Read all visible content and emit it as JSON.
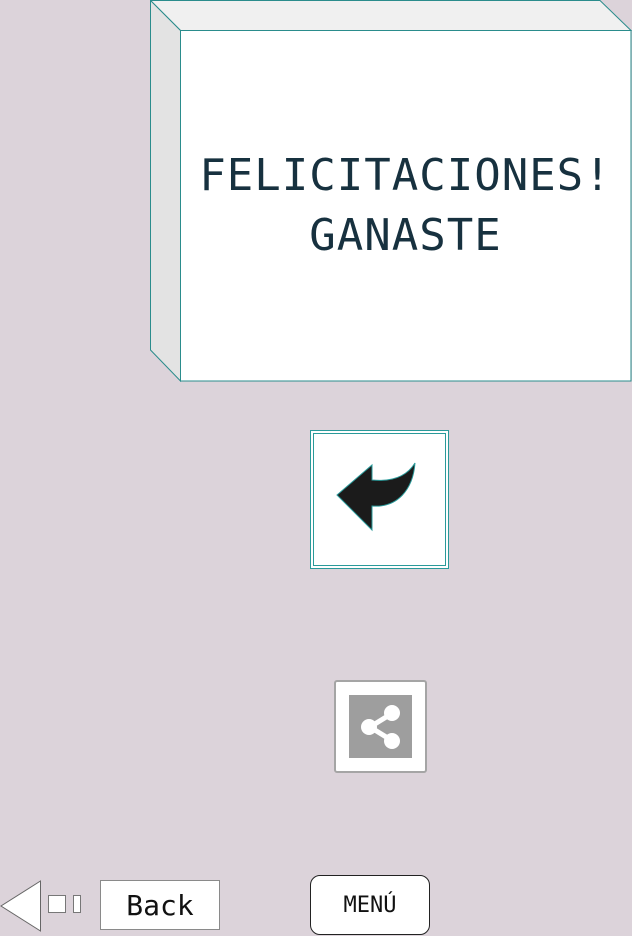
{
  "message": {
    "line1": "FELICITACIONES!",
    "line2": "GANASTE"
  },
  "buttons": {
    "return_icon": "return-arrow-icon",
    "share_icon": "share-icon",
    "back_label": "Back",
    "menu_label": "MENÚ"
  },
  "colors": {
    "background": "#dcd3da",
    "box_border": "#2a9a9a",
    "message_text": "#17313f",
    "share_gray": "#9e9e9e"
  }
}
